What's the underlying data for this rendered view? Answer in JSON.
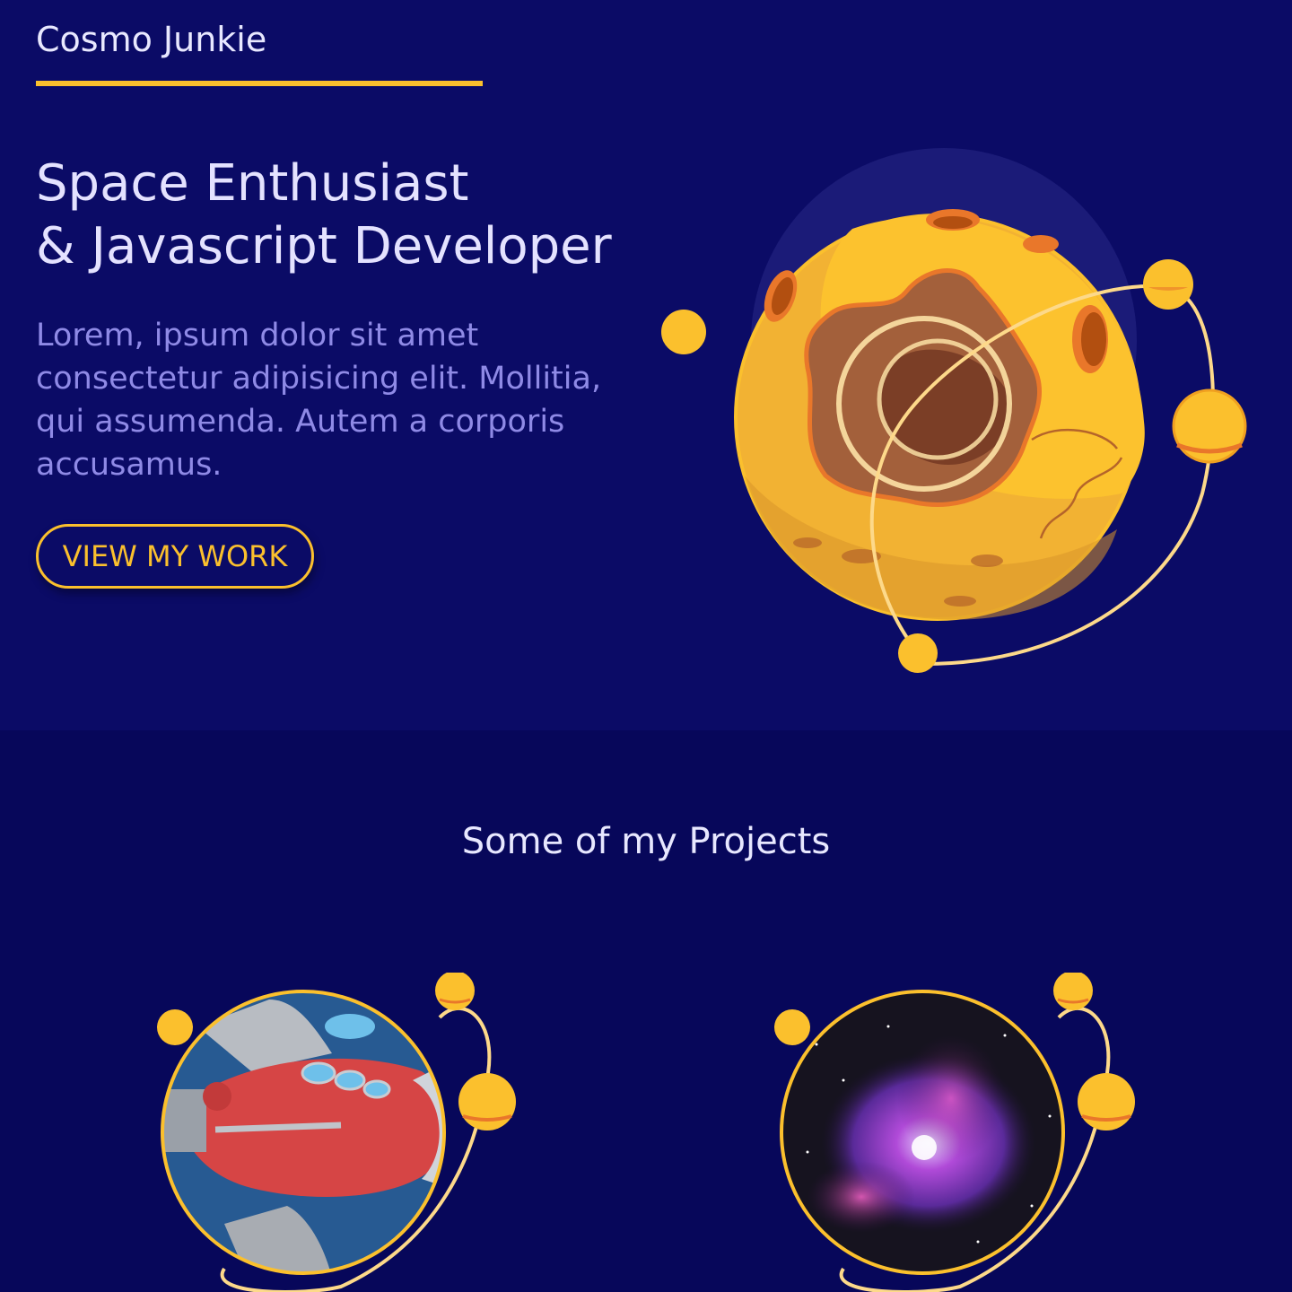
{
  "header": {
    "brand": "Cosmo Junkie"
  },
  "hero": {
    "headline_line1": "Space Enthusiast",
    "headline_line2": "& Javascript Developer",
    "intro": "Lorem, ipsum dolor sit amet consectetur adipisicing elit. Mollitia, qui assumenda. Autem a corporis accusamus.",
    "cta_label": "VIEW MY WORK"
  },
  "projects": {
    "title": "Some of my Projects",
    "items": [
      {
        "image": "rocket-ship-image"
      },
      {
        "image": "nebula-image"
      }
    ]
  },
  "colors": {
    "background": "#0b0b66",
    "projects_background": "#07075a",
    "accent": "#fbc02d",
    "heading_text": "#e4e2ff",
    "body_text": "#8f8ae6"
  }
}
